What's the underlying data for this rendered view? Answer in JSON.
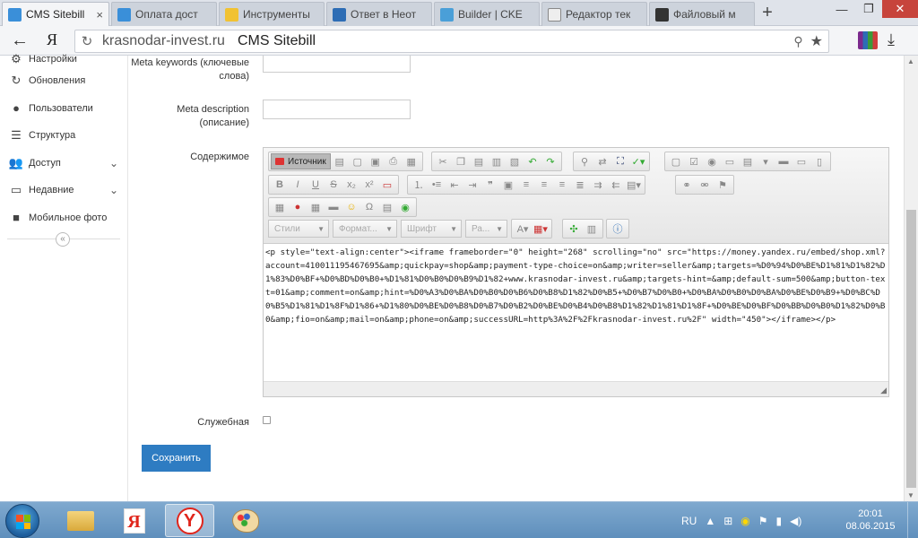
{
  "browser": {
    "tabs": [
      {
        "title": "CMS Sitebill",
        "favicon_color": "#3a8fd9",
        "active": true,
        "close": "×"
      },
      {
        "title": "Оплата дост",
        "favicon_color": "#3a8fd9",
        "active": false
      },
      {
        "title": "Инструменты",
        "favicon_color": "#f1c232",
        "active": false
      },
      {
        "title": "Ответ в Неот",
        "favicon_color": "#2d6db5",
        "active": false
      },
      {
        "title": "Builder | CKE",
        "favicon_color": "#4a9fd8",
        "active": false
      },
      {
        "title": "Редактор тек",
        "favicon_color": "#888888",
        "active": false
      },
      {
        "title": "Файловый м",
        "favicon_color": "#333333",
        "active": false
      }
    ],
    "new_tab": "+",
    "window_buttons": {
      "minimize": "—",
      "maximize": "❐",
      "close": "✕"
    },
    "back": "←",
    "ya": "Я",
    "url_domain": "krasnodar-invest.ru",
    "page_title": "CMS Sitebill",
    "reload": "↻",
    "search_icon": "⚲",
    "star": "★",
    "download": "⤓"
  },
  "sidebar": {
    "items": [
      {
        "label": "Настройки",
        "icon": "⚙"
      },
      {
        "label": "Обновления",
        "icon": "↻"
      },
      {
        "label": "Пользователи",
        "icon": "●"
      },
      {
        "label": "Структура",
        "icon": "☰"
      },
      {
        "label": "Доступ",
        "icon": "👥",
        "chevron": "⌄"
      },
      {
        "label": "Недавние",
        "icon": "▭",
        "chevron": "⌄"
      },
      {
        "label": "Мобильное фото",
        "icon": "■"
      }
    ],
    "collapse": "«"
  },
  "form": {
    "meta_keywords_label": "Meta keywords (ключевые слова)",
    "meta_description_label": "Meta description (описание)",
    "content_label": "Содержимое",
    "service_label": "Служебная",
    "save_button": "Сохранить",
    "editor": {
      "source_button": "Источник",
      "combos": {
        "styles": "Стили",
        "format": "Формат...",
        "font": "Шрифт",
        "size": "Ра..."
      },
      "source_text": "<p style=\"text-align:center\"><iframe frameborder=\"0\" height=\"268\" scrolling=\"no\" src=\"https://money.yandex.ru/embed/shop.xml?account=410011195467695&amp;quickpay=shop&amp;payment-type-choice=on&amp;writer=seller&amp;targets=%D0%94%D0%BE%D1%81%D1%82%D1%83%D0%BF+%D0%BD%D0%B0+%D1%81%D0%B0%D0%B9%D1%82+www.krasnodar-invest.ru&amp;targets-hint=&amp;default-sum=500&amp;button-text=01&amp;comment=on&amp;hint=%D0%A3%D0%BA%D0%B0%D0%B6%D0%B8%D1%82%D0%B5+%D0%B7%D0%B0+%D0%BA%D0%B0%D0%BA%D0%BE%D0%B9+%D0%BC%D0%B5%D1%81%D1%8F%D1%86+%D1%80%D0%BE%D0%B8%D0%B7%D0%B2%D0%BE%D0%B4%D0%B8%D1%82%D1%81%D1%8F+%D0%BE%D0%BF%D0%BB%D0%B0%D1%82%D0%B0&amp;fio=on&amp;mail=on&amp;phone=on&amp;successURL=http%3A%2F%2Fkrasnodar-invest.ru%2F\" width=\"450\"></iframe></p>"
    }
  },
  "taskbar": {
    "ya_label": "Я",
    "yabrowser_label": "Y",
    "tray": {
      "lang": "RU",
      "arrow": "▲"
    },
    "time": "20:01",
    "date": "08.06.2015"
  }
}
